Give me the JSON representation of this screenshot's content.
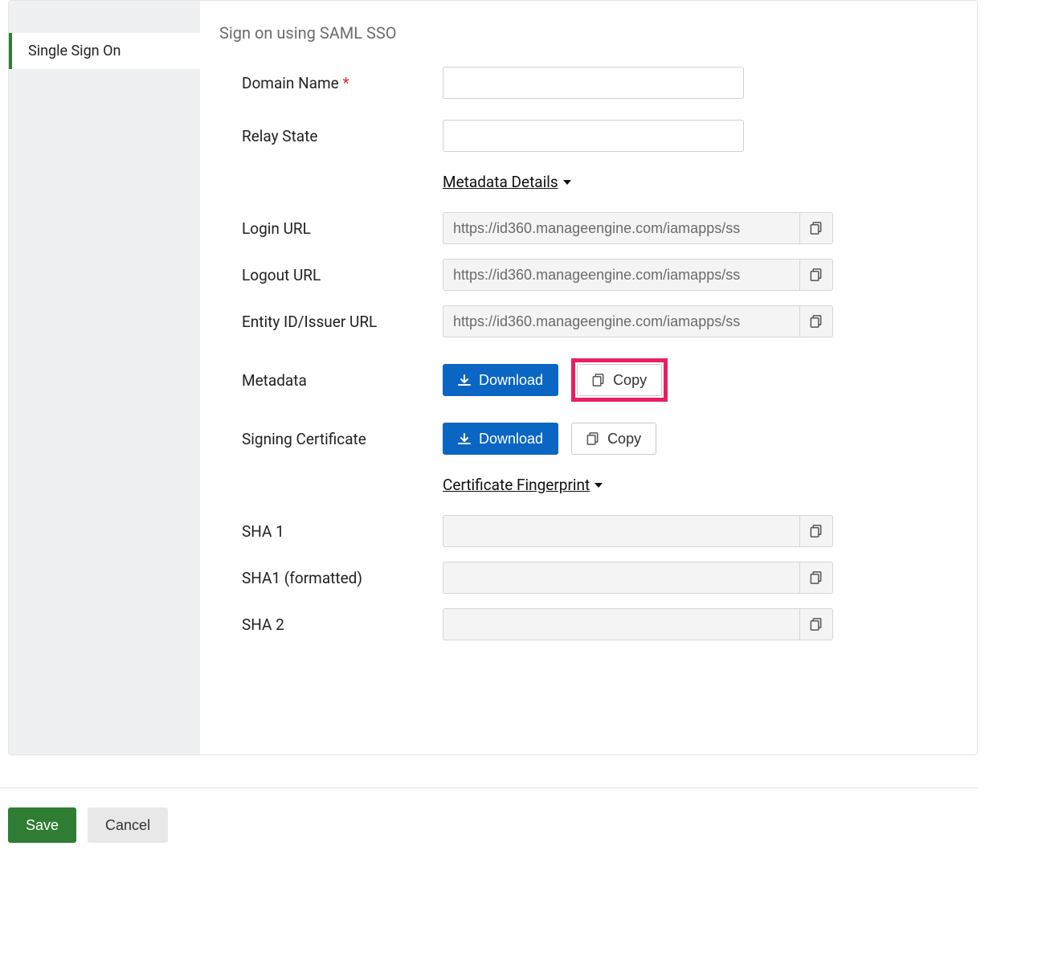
{
  "sidebar": {
    "active": "Single Sign On"
  },
  "header": {
    "title": "Sign on using SAML SSO"
  },
  "fields": {
    "domain_name_label": "Domain Name",
    "relay_state_label": "Relay State",
    "login_url_label": "Login URL",
    "logout_url_label": "Logout URL",
    "entity_id_label": "Entity ID/Issuer URL",
    "metadata_label": "Metadata",
    "signing_cert_label": "Signing Certificate",
    "sha1_label": "SHA 1",
    "sha1_formatted_label": "SHA1 (formatted)",
    "sha2_label": "SHA 2"
  },
  "values": {
    "domain_name": "",
    "relay_state": "",
    "login_url": "https://id360.manageengine.com/iamapps/ss",
    "logout_url": "https://id360.manageengine.com/iamapps/ss",
    "entity_id": "https://id360.manageengine.com/iamapps/ss",
    "sha1": "",
    "sha1_formatted": "",
    "sha2": ""
  },
  "toggles": {
    "metadata_details": "Metadata Details",
    "cert_fingerprint": "Certificate Fingerprint"
  },
  "buttons": {
    "download": "Download",
    "copy": "Copy",
    "save": "Save",
    "cancel": "Cancel"
  }
}
